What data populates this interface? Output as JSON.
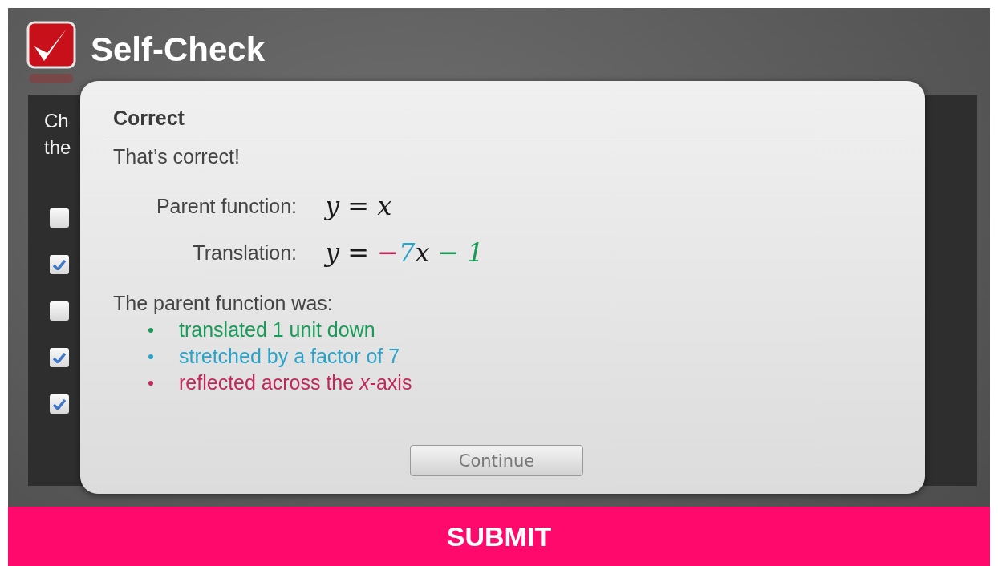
{
  "header": {
    "title": "Self-Check"
  },
  "question": {
    "lines": [
      "Ch",
      "the"
    ]
  },
  "options": [
    {
      "checked": false
    },
    {
      "checked": true
    },
    {
      "checked": false
    },
    {
      "checked": true
    },
    {
      "checked": true
    }
  ],
  "dialog": {
    "title": "Correct",
    "message": "That’s correct!",
    "equations": [
      {
        "label": "Parent function:",
        "terms": [
          {
            "text": "y = x",
            "color": "#1a1a1a"
          }
        ]
      },
      {
        "label": "Translation:",
        "terms": [
          {
            "text": "y = ",
            "color": "#1a1a1a"
          },
          {
            "text": "−",
            "color": "#c0285a"
          },
          {
            "text": "7",
            "color": "#2aa3c8"
          },
          {
            "text": "x",
            "color": "#1a1a1a"
          },
          {
            "text": " − 1",
            "color": "#1a9a58"
          }
        ]
      }
    ],
    "summary": "The parent function was:",
    "bullets": [
      {
        "text": "translated 1 unit down",
        "color": "#1a9a58"
      },
      {
        "text": "stretched by a factor of 7",
        "color": "#2aa3c8"
      },
      {
        "text": "reflected across the *x*-axis",
        "color": "#c0285a"
      }
    ],
    "button": "Continue"
  },
  "submit": "SUBMIT"
}
